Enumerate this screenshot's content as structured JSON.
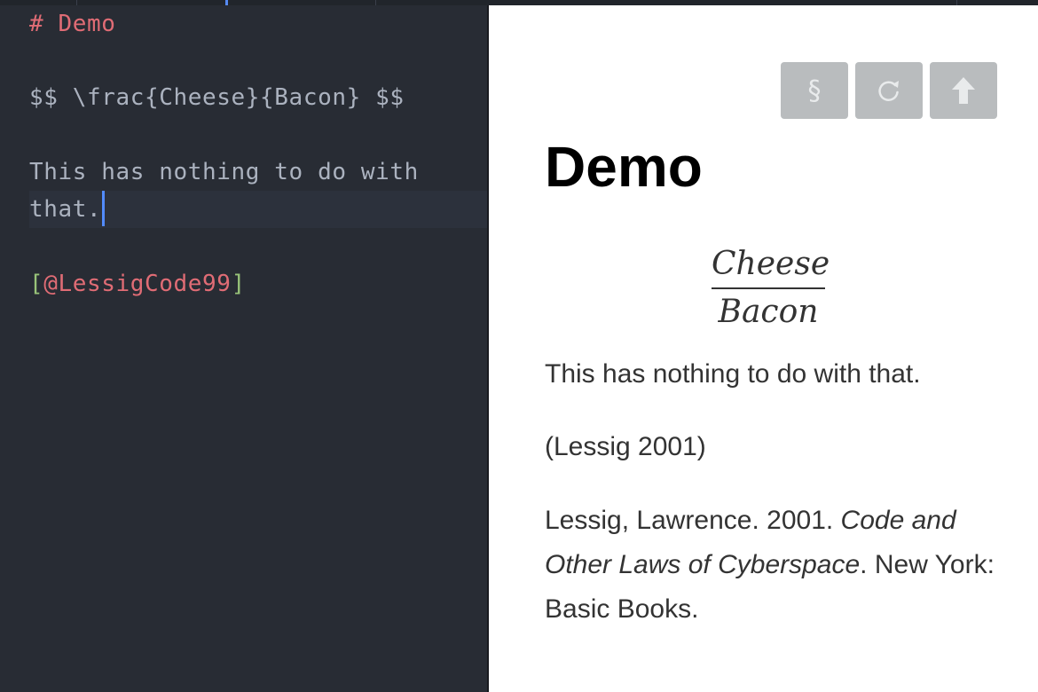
{
  "editor": {
    "lines": {
      "heading": "# Demo",
      "math": "$$ \\frac{Cheese}{Bacon} $$",
      "para_line1": "This has nothing to do with",
      "para_line2": "that.",
      "cite_open": "[",
      "cite_key": "@LessigCode99",
      "cite_close": "]"
    }
  },
  "preview": {
    "toolbar": {
      "section_label": "§",
      "refresh_icon": "refresh-icon",
      "upload_icon": "arrow-up-icon"
    },
    "title": "Demo",
    "math": {
      "numerator": "Cheese",
      "denominator": "Bacon"
    },
    "paragraph": "This has nothing to do with that.",
    "citation": "(Lessig 2001)",
    "reference": {
      "prefix": "Lessig, Lawrence. 2001. ",
      "title": "Code and Other Laws of Cyberspace",
      "suffix": ". New York: Basic Books."
    }
  },
  "colors": {
    "editor_bg": "#282c34",
    "markdown_heading": "#e06c75",
    "bracket": "#98c379",
    "cursor": "#528bff",
    "button_bg": "#b9bcbe"
  }
}
